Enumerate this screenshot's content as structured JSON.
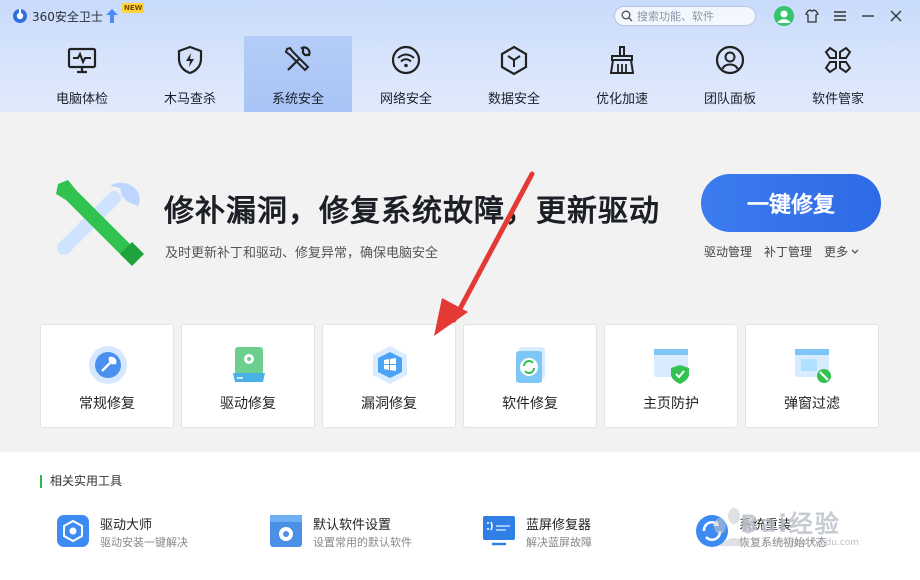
{
  "app": {
    "title": "360安全卫士",
    "new_badge": "NEW"
  },
  "search": {
    "placeholder": "搜索功能、软件"
  },
  "nav": [
    {
      "label": "电脑体检",
      "icon": "monitor-pulse-icon",
      "active": false
    },
    {
      "label": "木马查杀",
      "icon": "shield-bolt-icon",
      "active": false
    },
    {
      "label": "系统安全",
      "icon": "wrench-screwdriver-icon",
      "active": true
    },
    {
      "label": "网络安全",
      "icon": "wifi-icon",
      "active": false
    },
    {
      "label": "数据安全",
      "icon": "cube-icon",
      "active": false
    },
    {
      "label": "优化加速",
      "icon": "broom-icon",
      "active": false
    },
    {
      "label": "团队面板",
      "icon": "user-circle-icon",
      "active": false
    },
    {
      "label": "软件管家",
      "icon": "grid-flower-icon",
      "active": false
    }
  ],
  "hero": {
    "headline": "修补漏洞，修复系统故障，更新驱动",
    "subline": "及时更新补丁和驱动、修复异常，确保电脑安全",
    "fix_button": "一键修复",
    "links": [
      "驱动管理",
      "补丁管理",
      "更多"
    ]
  },
  "cards": [
    {
      "label": "常规修复",
      "icon": "wrench-circle-icon"
    },
    {
      "label": "驱动修复",
      "icon": "driver-disk-icon"
    },
    {
      "label": "漏洞修复",
      "icon": "windows-hexagon-icon"
    },
    {
      "label": "软件修复",
      "icon": "software-refresh-icon"
    },
    {
      "label": "主页防护",
      "icon": "browser-shield-icon"
    },
    {
      "label": "弹窗过滤",
      "icon": "popup-block-icon"
    }
  ],
  "tools": {
    "title": "相关实用工具",
    "items": [
      {
        "name": "驱动大师",
        "desc": "驱动安装一键解决",
        "icon": "driver-master-icon"
      },
      {
        "name": "默认软件设置",
        "desc": "设置常用的默认软件",
        "icon": "default-software-icon"
      },
      {
        "name": "蓝屏修复器",
        "desc": "解决蓝屏故障",
        "icon": "bluescreen-icon"
      },
      {
        "name": "系统重装",
        "desc": "恢复系统初始状态",
        "icon": "system-reinstall-icon"
      }
    ]
  },
  "watermark": {
    "text": "Bai经验",
    "sub": "jingyan.baidu.com"
  },
  "colors": {
    "accent": "#2e6ae6",
    "nav_active": "#a9c4f5",
    "arrow": "#e53935",
    "green": "#2cb64f"
  }
}
